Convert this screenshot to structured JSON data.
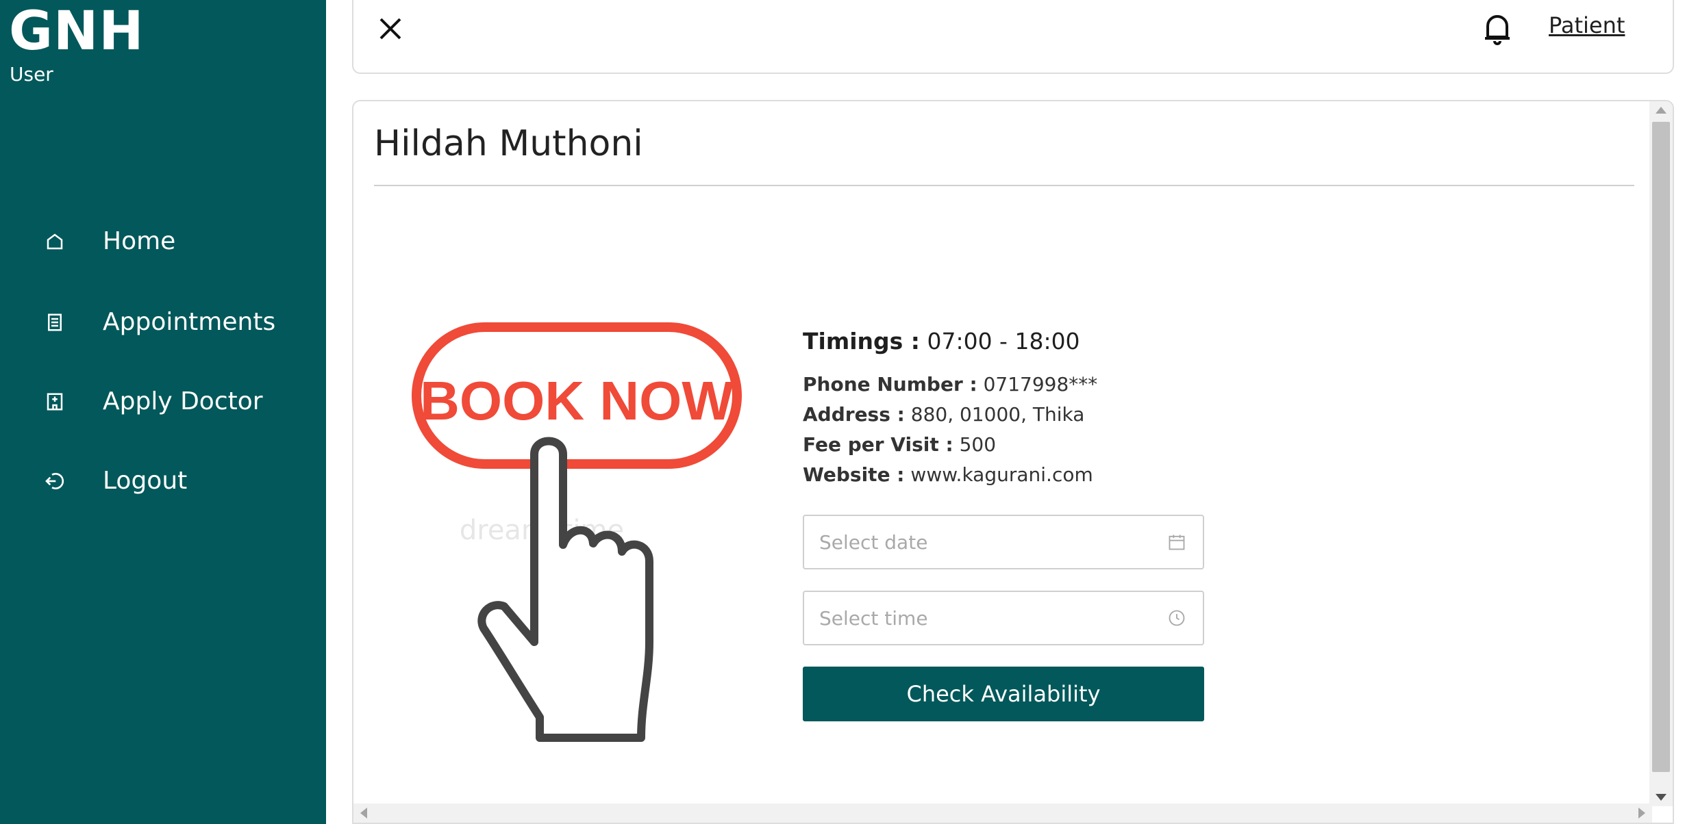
{
  "sidebar": {
    "brand": "GNH",
    "role": "User",
    "bg_color": "#02585a",
    "items": [
      {
        "label": "Home",
        "icon": "home-icon"
      },
      {
        "label": "Appointments",
        "icon": "list-icon"
      },
      {
        "label": "Apply Doctor",
        "icon": "hospital-icon"
      },
      {
        "label": "Logout",
        "icon": "logout-icon"
      }
    ]
  },
  "header": {
    "close_icon": "close-icon",
    "bell_icon": "bell-icon",
    "user_link": "Patient"
  },
  "doctor": {
    "name": "Hildah Muthoni",
    "promo_image": {
      "text": "BOOK NOW",
      "watermark": "dreamstime"
    },
    "timings_label": "Timings :",
    "timings_value": "07:00 - 18:00",
    "phone_label": "Phone Number :",
    "phone_value": "0717998***",
    "address_label": "Address :",
    "address_value": "880, 01000, Thika",
    "fee_label": "Fee per Visit :",
    "fee_value": "500",
    "website_label": "Website :",
    "website_value": "www.kagurani.com"
  },
  "booking": {
    "date_placeholder": "Select date",
    "time_placeholder": "Select time",
    "check_button": "Check Availability",
    "accent_color": "#02585a"
  }
}
